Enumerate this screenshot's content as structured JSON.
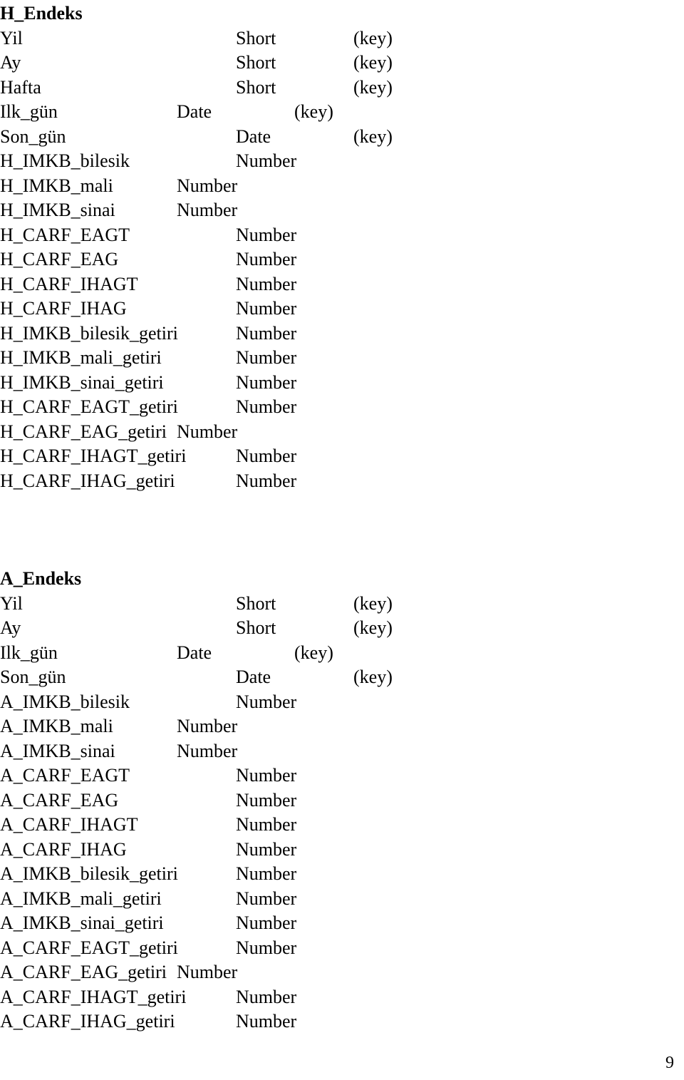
{
  "document": {
    "page_number": "9",
    "sections": [
      {
        "heading": "H_Endeks",
        "rows": [
          {
            "name": "Yil",
            "type": "Short",
            "key": "(key)",
            "type_tab": "b",
            "key_tab": "b"
          },
          {
            "name": "Ay",
            "type": "Short",
            "key": "(key)",
            "type_tab": "b",
            "key_tab": "b"
          },
          {
            "name": "Hafta",
            "type": "Short",
            "key": "(key)",
            "type_tab": "b",
            "key_tab": "b"
          },
          {
            "name": "Ilk_gün",
            "type": "Date",
            "key": "(key)",
            "type_tab": "a",
            "key_tab": "a"
          },
          {
            "name": "Son_gün",
            "type": "Date",
            "key": "(key)",
            "type_tab": "b",
            "key_tab": "b"
          },
          {
            "name": "H_IMKB_bilesik",
            "type": "Number",
            "key": "",
            "type_tab": "b",
            "key_tab": ""
          },
          {
            "name": "H_IMKB_mali",
            "type": "Number",
            "key": "",
            "type_tab": "a",
            "key_tab": ""
          },
          {
            "name": "H_IMKB_sinai",
            "type": "Number",
            "key": "",
            "type_tab": "a",
            "key_tab": ""
          },
          {
            "name": "H_CARF_EAGT",
            "type": "Number",
            "key": "",
            "type_tab": "b",
            "key_tab": ""
          },
          {
            "name": "H_CARF_EAG",
            "type": "Number",
            "key": "",
            "type_tab": "b",
            "key_tab": ""
          },
          {
            "name": "H_CARF_IHAGT",
            "type": "Number",
            "key": "",
            "type_tab": "b",
            "key_tab": ""
          },
          {
            "name": "H_CARF_IHAG",
            "type": "Number",
            "key": "",
            "type_tab": "b",
            "key_tab": ""
          },
          {
            "name": "H_IMKB_bilesik_getiri",
            "type": "Number",
            "key": "",
            "type_tab": "b",
            "key_tab": ""
          },
          {
            "name": "H_IMKB_mali_getiri",
            "type": "Number",
            "key": "",
            "type_tab": "b",
            "key_tab": ""
          },
          {
            "name": "H_IMKB_sinai_getiri",
            "type": "Number",
            "key": "",
            "type_tab": "b",
            "key_tab": ""
          },
          {
            "name": "H_CARF_EAGT_getiri",
            "type": "Number",
            "key": "",
            "type_tab": "b",
            "key_tab": ""
          },
          {
            "name": "H_CARF_EAG_getiri",
            "type": "Number",
            "key": "",
            "type_tab": "inline",
            "key_tab": ""
          },
          {
            "name": "H_CARF_IHAGT_getiri",
            "type": "Number",
            "key": "",
            "type_tab": "b",
            "key_tab": ""
          },
          {
            "name": "H_CARF_IHAG_getiri",
            "type": "Number",
            "key": "",
            "type_tab": "b",
            "key_tab": ""
          }
        ]
      },
      {
        "heading": "A_Endeks",
        "rows": [
          {
            "name": "Yil",
            "type": "Short",
            "key": "(key)",
            "type_tab": "b",
            "key_tab": "b"
          },
          {
            "name": "Ay",
            "type": "Short",
            "key": "(key)",
            "type_tab": "b",
            "key_tab": "b"
          },
          {
            "name": "Ilk_gün",
            "type": "Date",
            "key": "(key)",
            "type_tab": "a",
            "key_tab": "a"
          },
          {
            "name": "Son_gün",
            "type": "Date",
            "key": "(key)",
            "type_tab": "b",
            "key_tab": "b"
          },
          {
            "name": "A_IMKB_bilesik",
            "type": "Number",
            "key": "",
            "type_tab": "b",
            "key_tab": ""
          },
          {
            "name": "A_IMKB_mali",
            "type": "Number",
            "key": "",
            "type_tab": "a",
            "key_tab": ""
          },
          {
            "name": "A_IMKB_sinai",
            "type": "Number",
            "key": "",
            "type_tab": "a",
            "key_tab": ""
          },
          {
            "name": "A_CARF_EAGT",
            "type": "Number",
            "key": "",
            "type_tab": "b",
            "key_tab": ""
          },
          {
            "name": "A_CARF_EAG",
            "type": "Number",
            "key": "",
            "type_tab": "b",
            "key_tab": ""
          },
          {
            "name": "A_CARF_IHAGT",
            "type": "Number",
            "key": "",
            "type_tab": "b",
            "key_tab": ""
          },
          {
            "name": "A_CARF_IHAG",
            "type": "Number",
            "key": "",
            "type_tab": "b",
            "key_tab": ""
          },
          {
            "name": "A_IMKB_bilesik_getiri",
            "type": "Number",
            "key": "",
            "type_tab": "b",
            "key_tab": ""
          },
          {
            "name": "A_IMKB_mali_getiri",
            "type": "Number",
            "key": "",
            "type_tab": "b",
            "key_tab": ""
          },
          {
            "name": "A_IMKB_sinai_getiri",
            "type": "Number",
            "key": "",
            "type_tab": "b",
            "key_tab": ""
          },
          {
            "name": "A_CARF_EAGT_getiri",
            "type": "Number",
            "key": "",
            "type_tab": "b",
            "key_tab": ""
          },
          {
            "name": "A_CARF_EAG_getiri",
            "type": "Number",
            "key": "",
            "type_tab": "inline",
            "key_tab": ""
          },
          {
            "name": "A_CARF_IHAGT_getiri",
            "type": "Number",
            "key": "",
            "type_tab": "b",
            "key_tab": ""
          },
          {
            "name": "A_CARF_IHAG_getiri",
            "type": "Number",
            "key": "",
            "type_tab": "b",
            "key_tab": ""
          }
        ]
      }
    ]
  }
}
